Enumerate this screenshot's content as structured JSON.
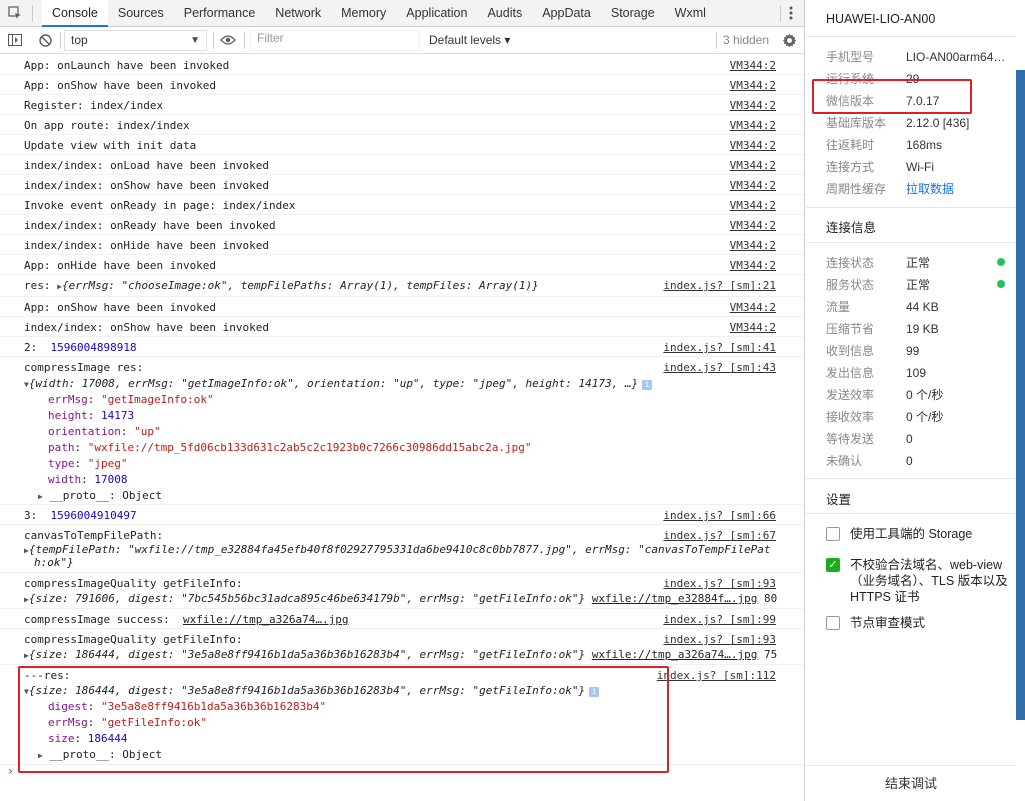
{
  "tabs": [
    "Console",
    "Sources",
    "Performance",
    "Network",
    "Memory",
    "Application",
    "Audits",
    "AppData",
    "Storage",
    "Wxml"
  ],
  "toolbar": {
    "context": "top",
    "filter_placeholder": "Filter",
    "levels": "Default levels ▾",
    "hidden": "3 hidden"
  },
  "logs": [
    {
      "text": "App: onLaunch have been invoked",
      "src": "VM344:2"
    },
    {
      "text": "App: onShow have been invoked",
      "src": "VM344:2"
    },
    {
      "text": "Register: index/index",
      "src": "VM344:2"
    },
    {
      "text": "On app route: index/index",
      "src": "VM344:2"
    },
    {
      "text": "Update view with init data",
      "src": "VM344:2"
    },
    {
      "text": "index/index: onLoad have been invoked",
      "src": "VM344:2"
    },
    {
      "text": "index/index: onShow have been invoked",
      "src": "VM344:2"
    },
    {
      "text": "Invoke event onReady in page: index/index",
      "src": "VM344:2"
    },
    {
      "text": "index/index: onReady have been invoked",
      "src": "VM344:2"
    },
    {
      "text": "index/index: onHide have been invoked",
      "src": "VM344:2"
    },
    {
      "text": "App: onHide have been invoked",
      "src": "VM344:2"
    }
  ],
  "res_line": {
    "prefix": "res: ",
    "obj": "{errMsg: \"chooseImage:ok\", tempFilePaths: Array(1), tempFiles: Array(1)}",
    "src": "index.js? [sm]:21"
  },
  "logs2": [
    {
      "text": "App: onShow have been invoked",
      "src": "VM344:2"
    },
    {
      "text": "index/index: onShow have been invoked",
      "src": "VM344:2"
    }
  ],
  "num_line1": {
    "label": "2:",
    "value": "1596004898918",
    "src": "index.js? [sm]:41"
  },
  "compress": {
    "title": "compressImage res:",
    "src": "index.js? [sm]:43",
    "summary": "{width: 17008, errMsg: \"getImageInfo:ok\", orientation: \"up\", type: \"jpeg\", height: 14173, …}",
    "props": [
      {
        "k": "errMsg",
        "v": "\"getImageInfo:ok\"",
        "t": "str"
      },
      {
        "k": "height",
        "v": "14173",
        "t": "num"
      },
      {
        "k": "orientation",
        "v": "\"up\"",
        "t": "str"
      },
      {
        "k": "path",
        "v": "\"wxfile://tmp_5fd06cb133d631c2ab5c2c1923b0c7266c30986dd15abc2a.jpg\"",
        "t": "str"
      },
      {
        "k": "type",
        "v": "\"jpeg\"",
        "t": "str"
      },
      {
        "k": "width",
        "v": "17008",
        "t": "num"
      }
    ],
    "proto": "__proto__: Object"
  },
  "num_line2": {
    "label": "3:",
    "value": "1596004910497",
    "src": "index.js? [sm]:66"
  },
  "canvas": {
    "title": "canvasToTempFilePath:",
    "src": "index.js? [sm]:67",
    "line1": "{tempFilePath: \"wxfile://tmp_e32884fa45efb40f8f02927795331da6be9410c8c0bb7877.jpg\", errMsg: \"canvasToTempFilePat",
    "line2": "h:ok\"}"
  },
  "quality1": {
    "title": "compressImageQuality getFileInfo:",
    "src": "index.js? [sm]:93",
    "summary": "{size: 791606, digest: \"7bc545b56bc31adca895c46be634179b\", errMsg: \"getFileInfo:ok\"}",
    "file": "wxfile://tmp_e32884f….jpg",
    "size": "80"
  },
  "success": {
    "title": "compressImage success:",
    "file": "wxfile://tmp_a326a74….jpg",
    "src": "index.js? [sm]:99"
  },
  "quality2": {
    "title": "compressImageQuality getFileInfo:",
    "src": "index.js? [sm]:93",
    "summary": "{size: 186444, digest: \"3e5a8e8ff9416b1da5a36b36b16283b4\", errMsg: \"getFileInfo:ok\"}",
    "file": "wxfile://tmp_a326a74….jpg",
    "size": "75"
  },
  "final": {
    "title": "---res:",
    "src": "index.js? [sm]:112",
    "summary": "{size: 186444, digest: \"3e5a8e8ff9416b1da5a36b36b16283b4\", errMsg: \"getFileInfo:ok\"}",
    "props": [
      {
        "k": "digest",
        "v": "\"3e5a8e8ff9416b1da5a36b36b16283b4\"",
        "t": "str"
      },
      {
        "k": "errMsg",
        "v": "\"getFileInfo:ok\"",
        "t": "str"
      },
      {
        "k": "size",
        "v": "186444",
        "t": "num"
      }
    ],
    "proto": "__proto__: Object"
  },
  "device": "HUAWEI-LIO-AN00",
  "info": [
    {
      "k": "手机型号",
      "v": "LIO-AN00arm64…"
    },
    {
      "k": "运行系统",
      "v": "29"
    },
    {
      "k": "微信版本",
      "v": "7.0.17"
    },
    {
      "k": "基础库版本",
      "v": "2.12.0 [436]"
    },
    {
      "k": "往返耗时",
      "v": "168ms"
    },
    {
      "k": "连接方式",
      "v": "Wi-Fi"
    },
    {
      "k": "周期性缓存",
      "v": "拉取数据",
      "link": true
    }
  ],
  "conn_title": "连接信息",
  "conn": [
    {
      "k": "连接状态",
      "v": "正常",
      "dot": true
    },
    {
      "k": "服务状态",
      "v": "正常",
      "dot": true
    },
    {
      "k": "流量",
      "v": "44 KB"
    },
    {
      "k": "压缩节省",
      "v": "19 KB"
    },
    {
      "k": "收到信息",
      "v": "99"
    },
    {
      "k": "发出信息",
      "v": "109"
    },
    {
      "k": "发送效率",
      "v": "0 个/秒"
    },
    {
      "k": "接收效率",
      "v": "0 个/秒"
    },
    {
      "k": "等待发送",
      "v": "0"
    },
    {
      "k": "未确认",
      "v": "0"
    }
  ],
  "settings_title": "设置",
  "settings": [
    {
      "label": "使用工具端的 Storage",
      "checked": false
    },
    {
      "label": "不校验合法域名、web-view（业务域名）、TLS 版本以及 HTTPS 证书",
      "checked": true
    },
    {
      "label": "节点审查模式",
      "checked": false
    }
  ],
  "end_button": "结束调试",
  "colors": {
    "accent": "#1a73e8",
    "highlight": "#e02020",
    "ok": "#22c35e",
    "check": "#1aad19"
  }
}
